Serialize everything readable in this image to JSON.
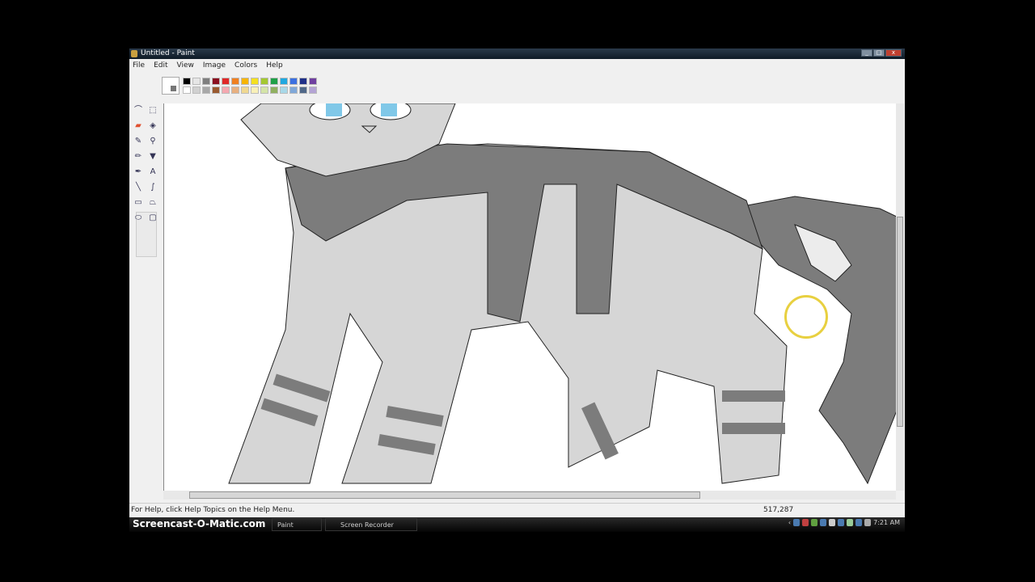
{
  "window": {
    "title": "Untitled - Paint",
    "controls": [
      "minimize",
      "maximize",
      "close"
    ]
  },
  "menu": [
    "File",
    "Edit",
    "View",
    "Image",
    "Colors",
    "Help"
  ],
  "palette": {
    "top": [
      "#000000",
      "#e6e6e6",
      "#7f7f7f",
      "#8b1020",
      "#e02828",
      "#f08020",
      "#f7b500",
      "#f4e020",
      "#a4c830",
      "#20a048",
      "#20a8e0",
      "#3c70e0",
      "#203088",
      "#7040a0"
    ],
    "bottom": [
      "#ffffff",
      "#d0d0d0",
      "#a8a8a8",
      "#9a5a30",
      "#f4a8b0",
      "#e8b080",
      "#f0d890",
      "#f8f0b8",
      "#d4e4a8",
      "#90b060",
      "#a8d8e8",
      "#80a8d8",
      "#506888",
      "#b4a4d4"
    ]
  },
  "tools": [
    {
      "name": "free-select",
      "glyph": "⌒"
    },
    {
      "name": "select",
      "glyph": "⬚"
    },
    {
      "name": "eraser",
      "glyph": "▰"
    },
    {
      "name": "fill",
      "glyph": "◈"
    },
    {
      "name": "color-picker",
      "glyph": "✎"
    },
    {
      "name": "magnifier",
      "glyph": "⚲"
    },
    {
      "name": "pencil",
      "glyph": "✏"
    },
    {
      "name": "brush",
      "glyph": "▼"
    },
    {
      "name": "airbrush",
      "glyph": "✒"
    },
    {
      "name": "text",
      "glyph": "A"
    },
    {
      "name": "line",
      "glyph": "╲"
    },
    {
      "name": "curve",
      "glyph": "∫"
    },
    {
      "name": "rectangle",
      "glyph": "▭"
    },
    {
      "name": "polygon",
      "glyph": "⏢"
    },
    {
      "name": "ellipse",
      "glyph": "⬭"
    },
    {
      "name": "rounded-rectangle",
      "glyph": "▢"
    }
  ],
  "status": {
    "help": "For Help, click Help Topics on the Help Menu.",
    "coords": "517,287"
  },
  "taskbar": {
    "brand": "Screencast-O-Matic.com",
    "tasks": [
      "Paint",
      "Screen Recorder"
    ],
    "clock": "7:21 AM"
  },
  "colors": {
    "cat_light": "#d6d6d6",
    "cat_dark": "#7c7c7c",
    "cat_white": "#ececec",
    "eye": "#80c8e8"
  }
}
